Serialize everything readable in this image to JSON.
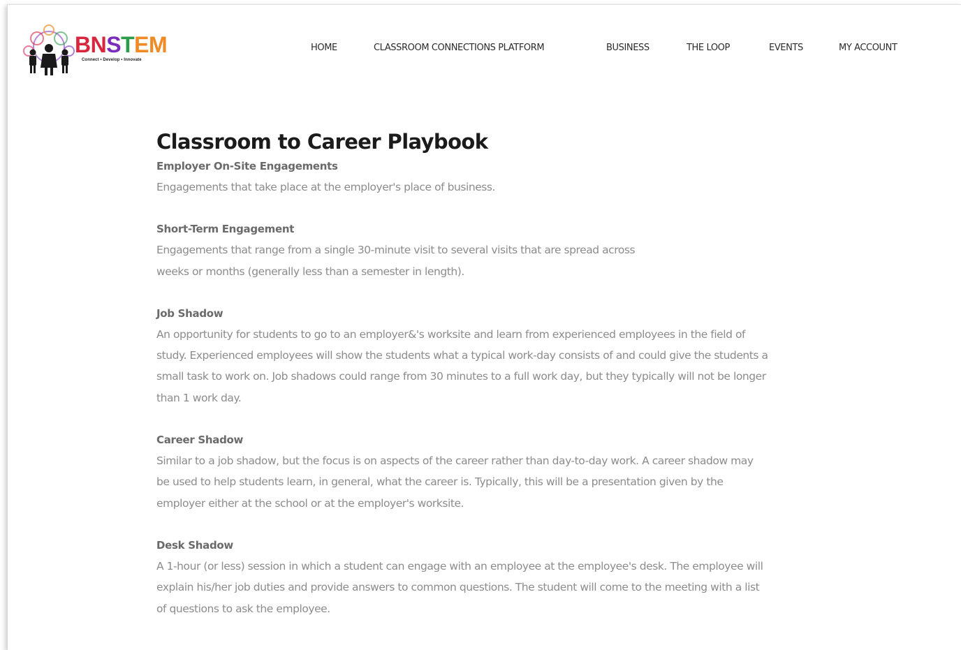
{
  "logo": {
    "wordmark": [
      "BN",
      "S",
      "T",
      "E",
      "M"
    ],
    "tagline": "Connect • Develop • Innovate",
    "colors": {
      "b": "#d7263d",
      "n": "#e0245e",
      "s": "#7b2cbf",
      "t": "#2d9c4a",
      "e": "#f08a24",
      "m": "#f08a24"
    }
  },
  "nav": {
    "items": [
      {
        "label": "HOME"
      },
      {
        "label": "CLASSROOM CONNECTIONS PLATFORM"
      },
      {
        "label": "BUSINESS"
      },
      {
        "label": "THE LOOP"
      },
      {
        "label": "EVENTS"
      },
      {
        "label": "MY ACCOUNT"
      }
    ]
  },
  "page": {
    "title": "Classroom to Career Playbook",
    "sections": [
      {
        "heading": "Employer On-Site Engagements",
        "body": "Engagements that take place at the employer's place of business."
      },
      {
        "heading": "Short-Term Engagement",
        "body": "Engagements that range from a single 30-minute visit to several visits that are spread across weeks or months (generally less than a semester in length)."
      },
      {
        "heading": "Job Shadow",
        "body": "An opportunity for students to go to an employer&'s worksite and learn from experienced employees in the field of study. Experienced employees will show the students what a typical work-day consists of and could give the students a small task to work on. Job shadows could range from 30 minutes to a full work day, but they typically will not be longer than 1 work day."
      },
      {
        "heading": "Career Shadow",
        "body": "Similar to a job shadow, but the focus is on aspects of the career rather than day-to-day work. A career shadow may be used to help students learn, in general, what the career is. Typically, this will be a presentation given by the employer either at the school or at the employer's worksite."
      },
      {
        "heading": "Desk Shadow",
        "body": "A 1-hour (or less) session in which a student can engage with an employee at the employee's desk. The employee will explain his/her job duties and provide answers to common questions. The student will come to the meeting with a list of questions to ask the employee."
      }
    ]
  }
}
